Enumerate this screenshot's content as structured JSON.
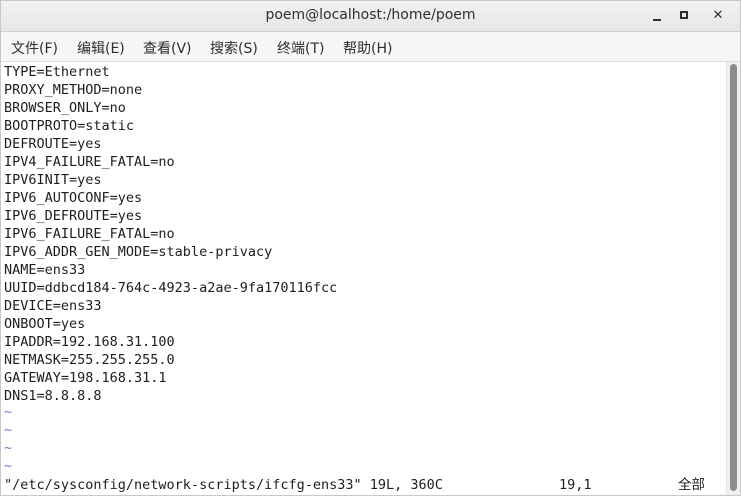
{
  "window": {
    "title": "poem@localhost:/home/poem"
  },
  "menu": {
    "items": [
      {
        "label": "文件(F)"
      },
      {
        "label": "编辑(E)"
      },
      {
        "label": "查看(V)"
      },
      {
        "label": "搜索(S)"
      },
      {
        "label": "终端(T)"
      },
      {
        "label": "帮助(H)"
      }
    ]
  },
  "terminal": {
    "lines": [
      "TYPE=Ethernet",
      "PROXY_METHOD=none",
      "BROWSER_ONLY=no",
      "BOOTPROTO=static",
      "DEFROUTE=yes",
      "IPV4_FAILURE_FATAL=no",
      "IPV6INIT=yes",
      "IPV6_AUTOCONF=yes",
      "IPV6_DEFROUTE=yes",
      "IPV6_FAILURE_FATAL=no",
      "IPV6_ADDR_GEN_MODE=stable-privacy",
      "NAME=ens33",
      "UUID=ddbcd184-764c-4923-a2ae-9fa170116fcc",
      "DEVICE=ens33",
      "ONBOOT=yes",
      "IPADDR=192.168.31.100",
      "NETMASK=255.255.255.0",
      "GATEWAY=198.168.31.1",
      "DNS1=8.8.8.8"
    ],
    "tildes": [
      "~",
      "~",
      "~",
      "~"
    ],
    "status": {
      "file": "\"/etc/sysconfig/network-scripts/ifcfg-ens33\" 19L, 360C",
      "position": "19,1",
      "percent": "全部"
    }
  }
}
